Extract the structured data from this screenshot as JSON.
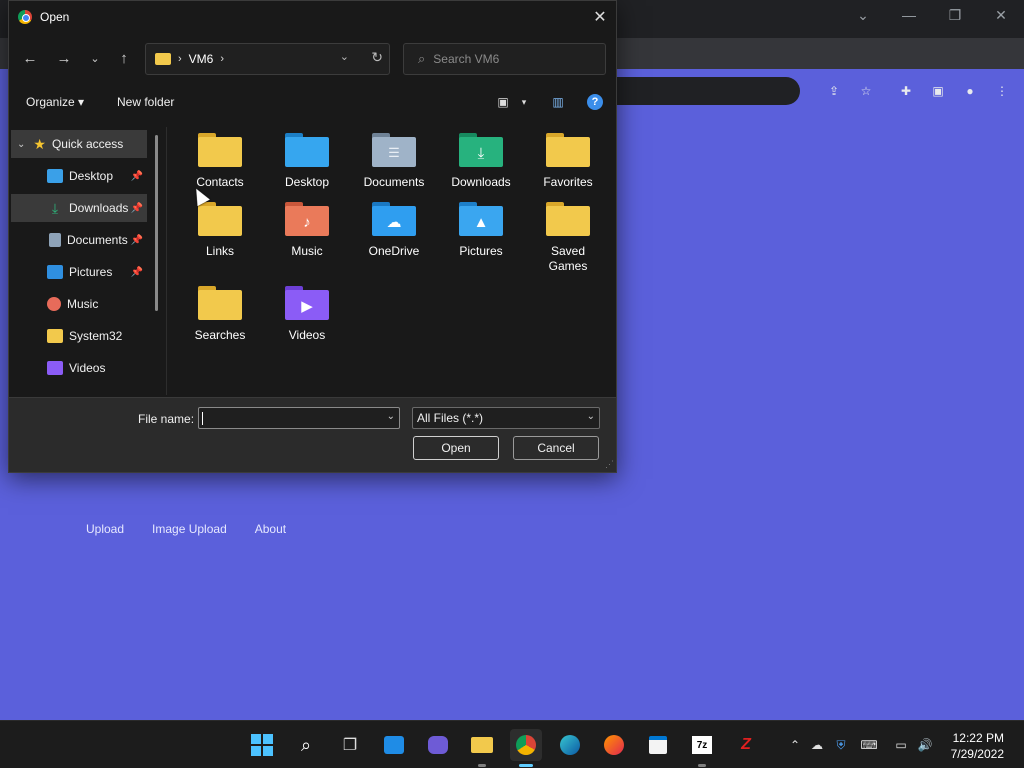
{
  "browser": {
    "links": [
      "Upload",
      "Image Upload",
      "About"
    ]
  },
  "dialog": {
    "title": "Open",
    "address": {
      "segments": [
        "VM6"
      ]
    },
    "search_placeholder": "Search VM6",
    "toolbar": {
      "organize": "Organize",
      "new_folder": "New folder"
    },
    "nav_pane": {
      "quick_access": "Quick access",
      "items": [
        {
          "label": "Desktop",
          "pinned": true,
          "icon": "desktop-icon",
          "color": "#3aa0e8"
        },
        {
          "label": "Downloads",
          "pinned": true,
          "icon": "download-icon",
          "color": "#2db37a",
          "selected": true
        },
        {
          "label": "Documents",
          "pinned": true,
          "icon": "documents-icon",
          "color": "#8ea3b8"
        },
        {
          "label": "Pictures",
          "pinned": true,
          "icon": "pictures-icon",
          "color": "#2f8fe0"
        },
        {
          "label": "Music",
          "pinned": false,
          "icon": "music-icon",
          "color": "#e76b5a"
        },
        {
          "label": "System32",
          "pinned": false,
          "icon": "folder-icon",
          "color": "#f2c94c"
        },
        {
          "label": "Videos",
          "pinned": false,
          "icon": "videos-icon",
          "color": "#8b5cf6"
        }
      ]
    },
    "files": [
      {
        "label": "Contacts",
        "icon": "contacts-folder-icon",
        "color": "#f2c94c"
      },
      {
        "label": "Desktop",
        "icon": "desktop-folder-icon",
        "color": "#36a6ef"
      },
      {
        "label": "Documents",
        "icon": "documents-folder-icon",
        "color": "#9fb3c8"
      },
      {
        "label": "Downloads",
        "icon": "downloads-folder-icon",
        "color": "#27b27e"
      },
      {
        "label": "Favorites",
        "icon": "favorites-folder-icon",
        "color": "#f2c94c"
      },
      {
        "label": "Links",
        "icon": "links-folder-icon",
        "color": "#f2c94c"
      },
      {
        "label": "Music",
        "icon": "music-folder-icon",
        "color": "#ea7a5a"
      },
      {
        "label": "OneDrive",
        "icon": "onedrive-folder-icon",
        "color": "#2f9ef0"
      },
      {
        "label": "Pictures",
        "icon": "pictures-folder-icon",
        "color": "#3aa6f0"
      },
      {
        "label": "Saved\nGames",
        "icon": "saved-games-folder-icon",
        "color": "#f2c94c"
      },
      {
        "label": "Searches",
        "icon": "searches-folder-icon",
        "color": "#f2c94c"
      },
      {
        "label": "Videos",
        "icon": "videos-folder-icon",
        "color": "#8b5cf6"
      }
    ],
    "footer": {
      "file_name_label": "File name:",
      "file_name_value": "",
      "file_type": "All Files (*.*)",
      "open_button": "Open",
      "cancel_button": "Cancel"
    }
  },
  "taskbar": {
    "time": "12:22 PM",
    "date": "7/29/2022"
  }
}
